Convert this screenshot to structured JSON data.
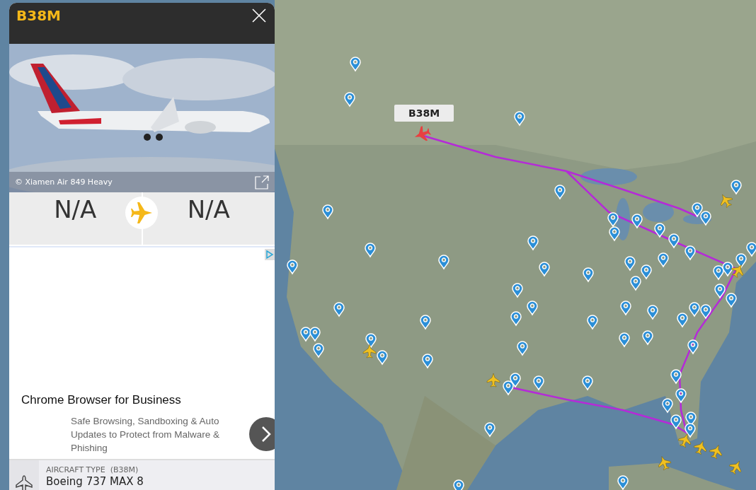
{
  "panel": {
    "title": "B38M",
    "photo": {
      "kind": "picture",
      "credit": "© Xiamen Air 849 Heavy"
    },
    "route": {
      "origin": "N/A",
      "destination": "N/A"
    },
    "ad": {
      "headline": "Chrome Browser for Business",
      "body": "Safe Browsing, Sandboxing & Auto Updates to Protect from Malware & Phishing"
    },
    "aircraft": {
      "label": "AIRCRAFT TYPE",
      "code": "(B38M)",
      "value": "Boeing 737 MAX 8"
    }
  },
  "map": {
    "kind": "picture",
    "flight_label": "B38M"
  }
}
